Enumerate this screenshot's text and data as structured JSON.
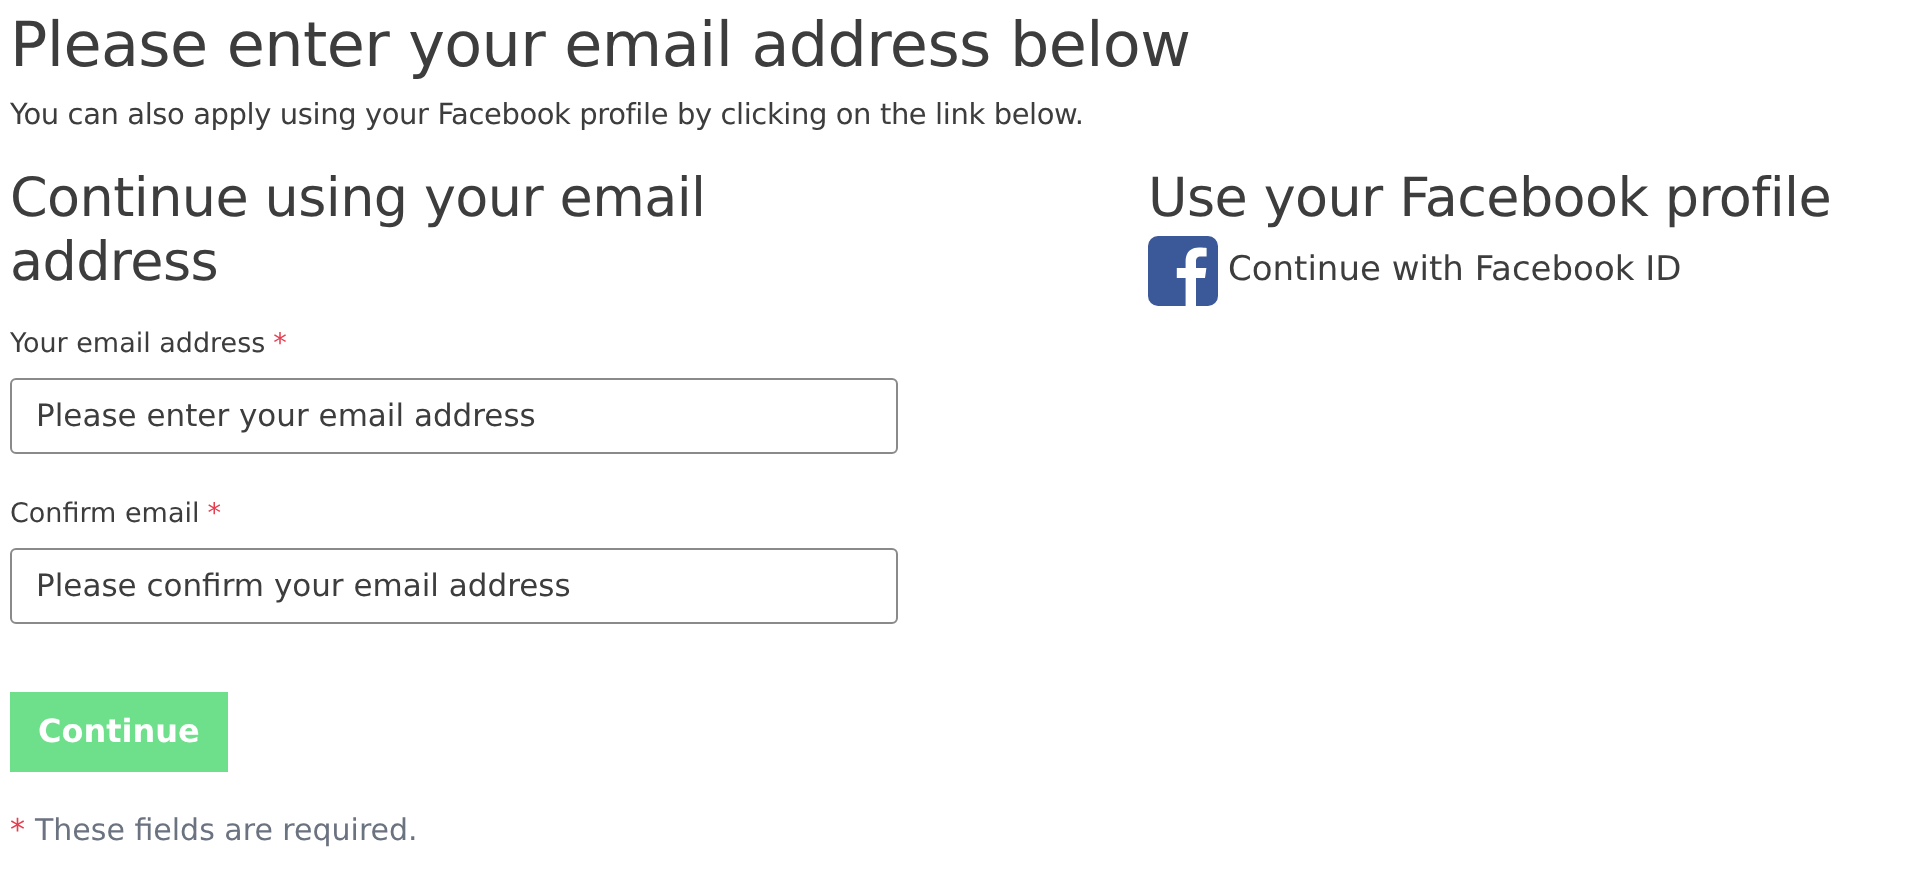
{
  "title": "Please enter your email address below",
  "subtitle": "You can also apply using your Facebook profile by clicking on the link below.",
  "email_section": {
    "heading": "Continue using your email address",
    "fields": [
      {
        "label": "Your email address",
        "required_mark": "*",
        "placeholder": "Please enter your email address"
      },
      {
        "label": "Confirm email",
        "required_mark": "*",
        "placeholder": "Please confirm your email address"
      }
    ],
    "button": {
      "label": "Continue",
      "disabled": true
    },
    "note": {
      "mark": "*",
      "text": "These fields are required."
    }
  },
  "facebook_section": {
    "heading": "Use your Facebook profile",
    "link": "Continue with Facebook ID"
  }
}
